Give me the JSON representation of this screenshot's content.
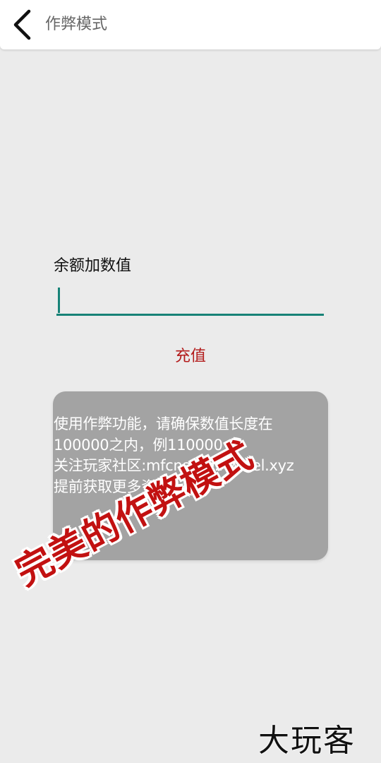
{
  "header": {
    "title": "作弊模式",
    "back_icon": "chevron-left-icon"
  },
  "form": {
    "label": "余额加数值",
    "input_value": "",
    "input_placeholder": "",
    "submit_label": "充值"
  },
  "notice": {
    "lines": [
      "使用作弊功能，请确保数值长度在",
      "100000之内，例110000",
      "关注玩家社区:mfcname.hwwel.xyz",
      "提前获取更多资讯"
    ]
  },
  "overlay": {
    "stamp_text": "完美的作弊模式",
    "watermark_text": "大玩客"
  },
  "colors": {
    "accent": "#178277",
    "submit_text": "#b31b1b",
    "notice_bg": "#a3a3a3",
    "stamp": "#c21111"
  }
}
